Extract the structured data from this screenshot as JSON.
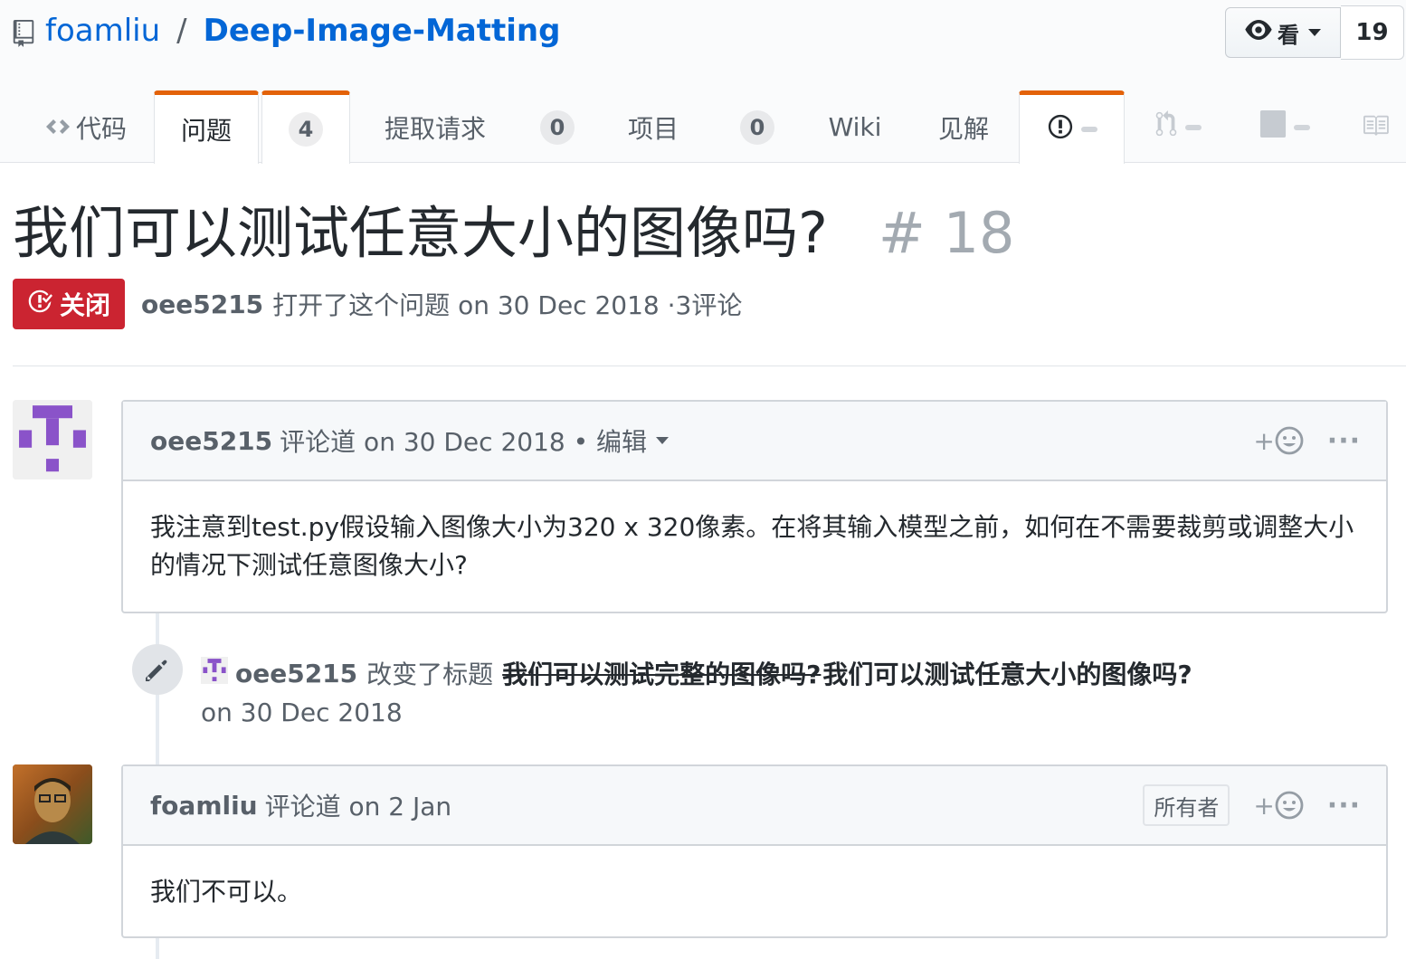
{
  "repo": {
    "owner": "foamliu",
    "separator": "/",
    "name": "Deep-Image-Matting",
    "watch_label": "看",
    "watch_count": "19"
  },
  "tabs": [
    {
      "label": "代码",
      "icon": "code-icon"
    },
    {
      "label": "问题",
      "counter": "4",
      "selected": true
    },
    {
      "label": "提取请求",
      "counter": "0"
    },
    {
      "label": "项目",
      "counter": "0"
    },
    {
      "label": "Wiki"
    },
    {
      "label": "见解"
    },
    {
      "icon": "issue-opened-icon",
      "selected": true
    },
    {
      "icon": "pull-request-icon"
    },
    {
      "icon": "project-icon"
    },
    {
      "icon": "book-icon"
    }
  ],
  "issue": {
    "title": "我们可以测试任意大小的图像吗?",
    "number": "# 18",
    "state": "关闭",
    "author": "oee5215",
    "opened_text": "打开了这个问题 on 30 Dec 2018 ·3评论"
  },
  "comments": [
    {
      "author": "oee5215",
      "header_text": "评论道 on 30 Dec 2018 • 编辑",
      "body": "我注意到test.py假设输入图像大小为320 x 320像素。在将其输入模型之前，如何在不需要裁剪或调整大小的情况下测试任意图像大小?",
      "reaction": "+",
      "more": "···"
    },
    {
      "author": "foamliu",
      "header_text": "评论道 on 2 Jan",
      "badge": "所有者",
      "body": "我们不可以。",
      "reaction": "+",
      "more": "···"
    }
  ],
  "event": {
    "author": "oee5215",
    "action": "改变了标题",
    "old_title": "我们可以测试完整的图像吗?",
    "new_title": "我们可以测试任意大小的图像吗?",
    "date": "on 30 Dec 2018"
  },
  "colors": {
    "link": "#0366d6",
    "closed": "#cb2431",
    "tab_accent": "#e36209",
    "identicon": "#8a53c9"
  }
}
